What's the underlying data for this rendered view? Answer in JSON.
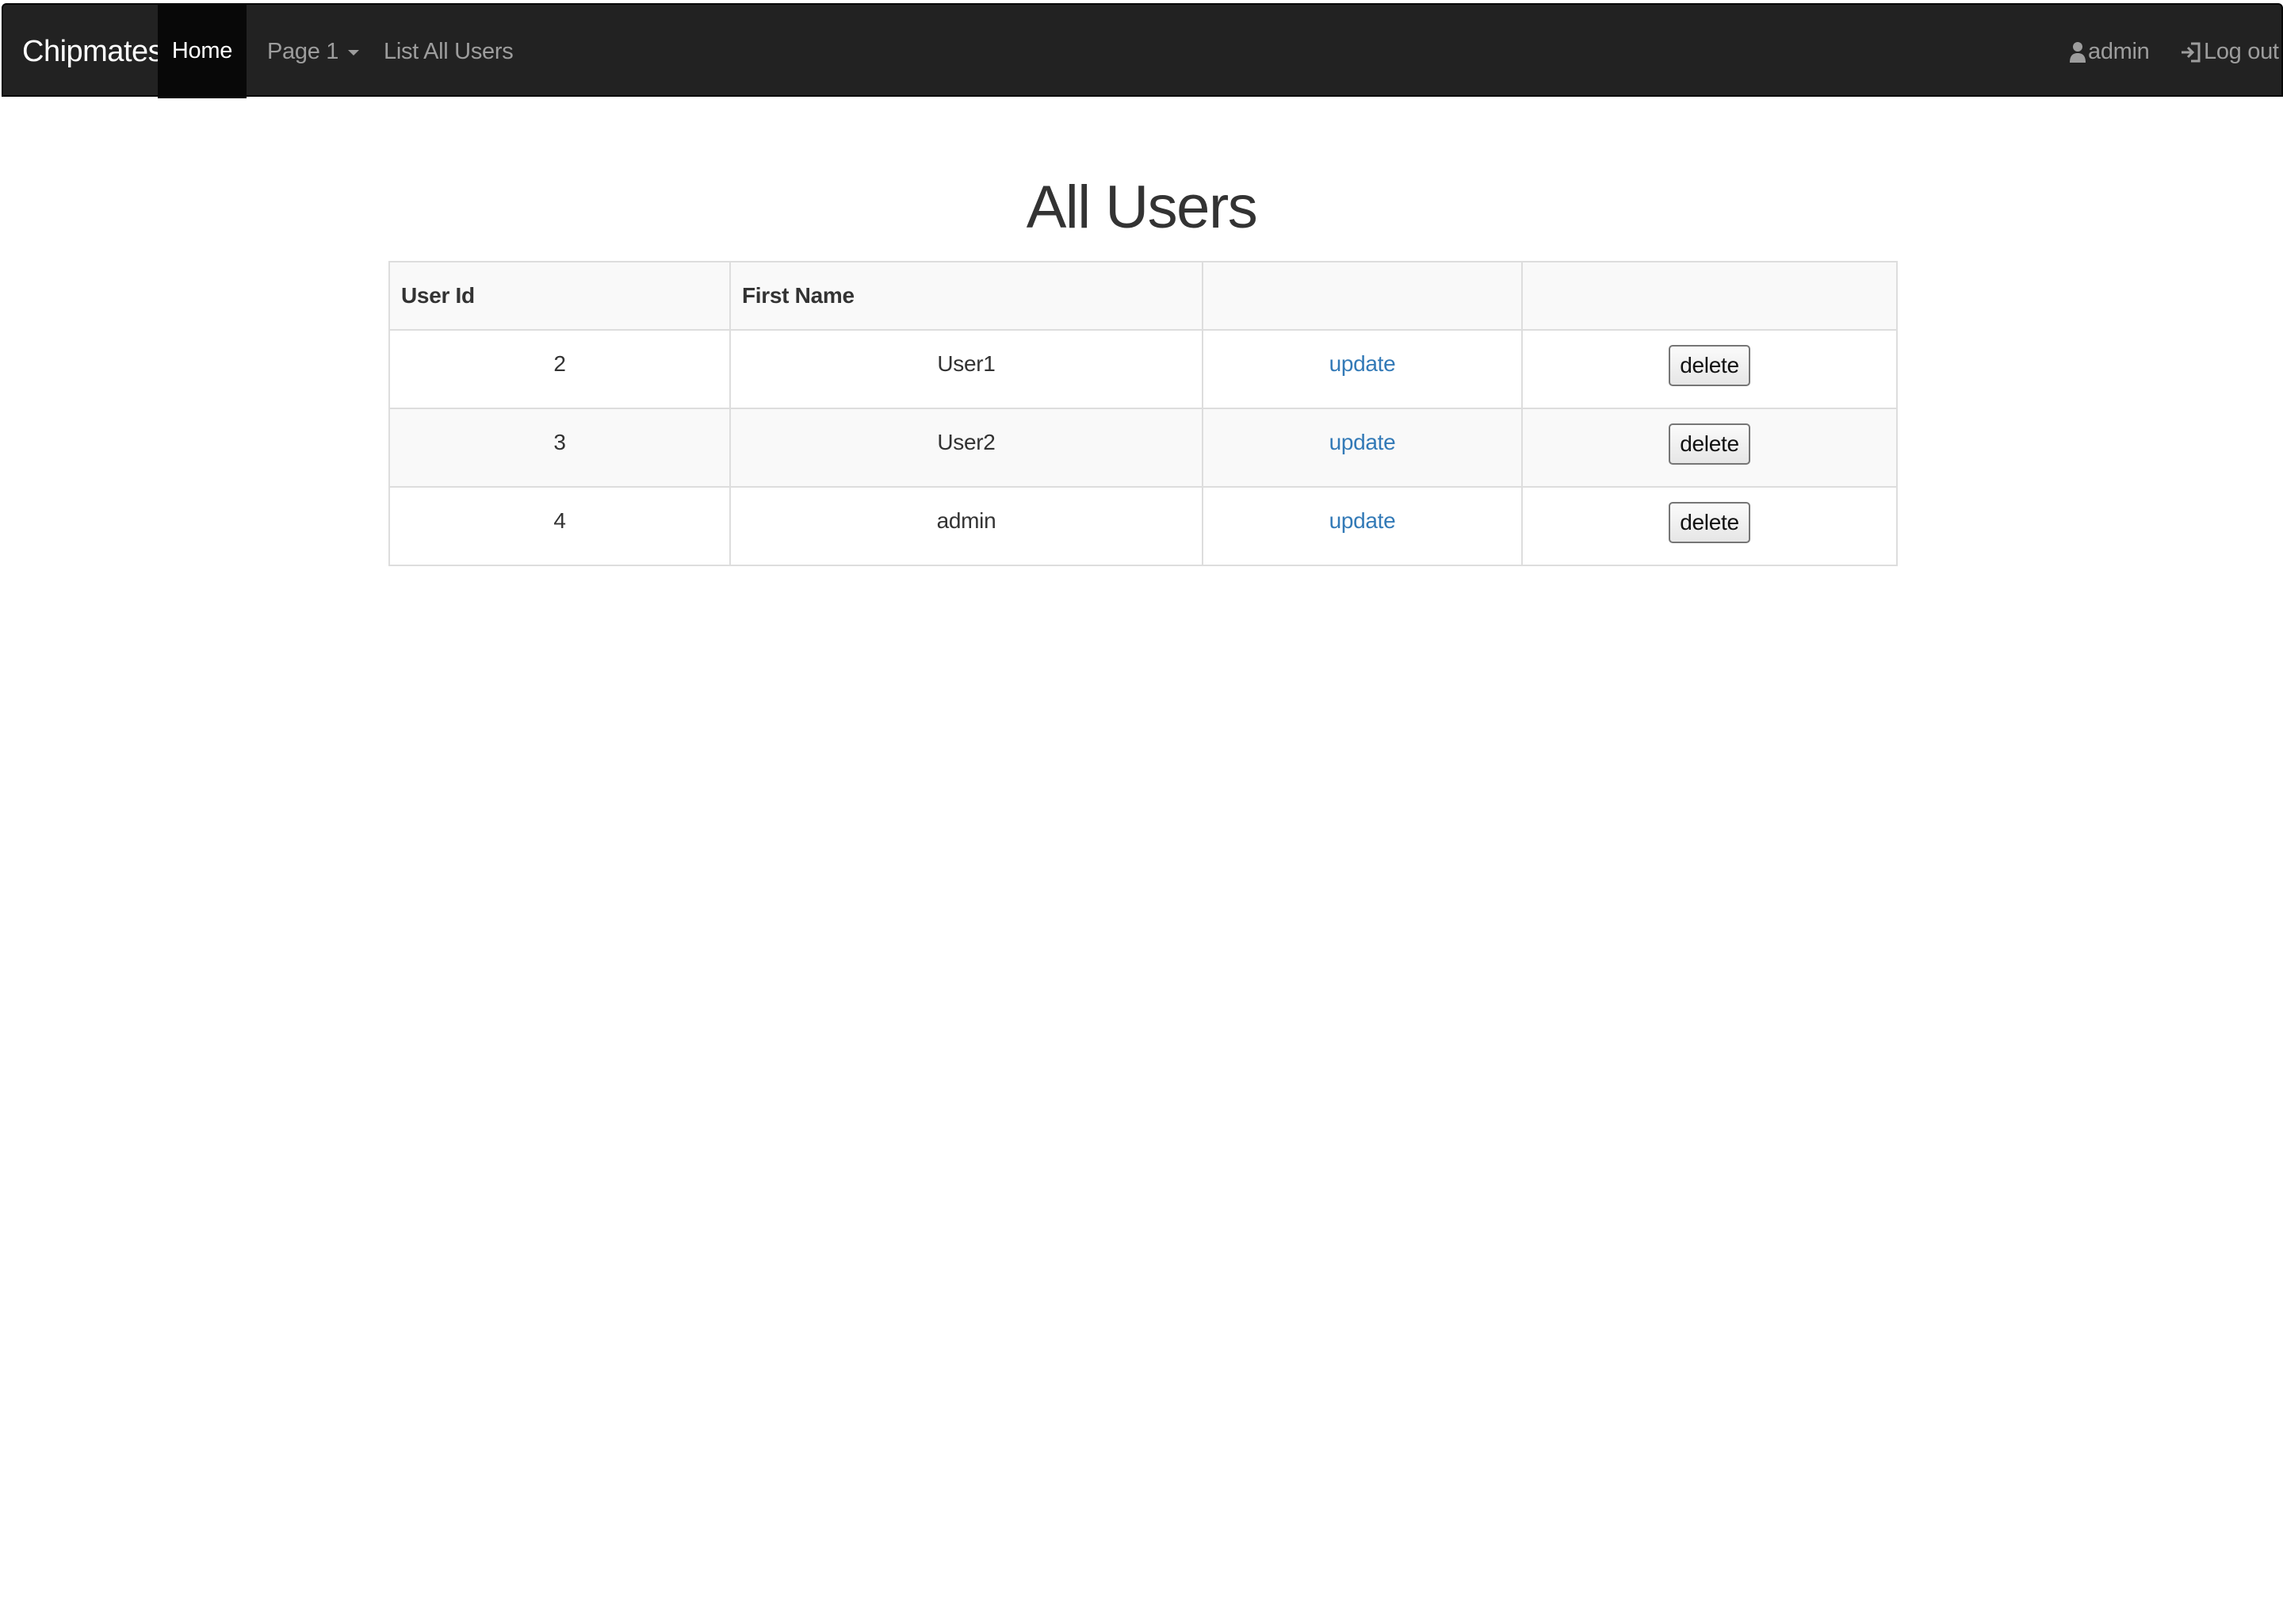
{
  "navbar": {
    "brand": "Chipmates",
    "items": [
      {
        "label": "Home",
        "active": true
      },
      {
        "label": "Page 1",
        "dropdown": true
      },
      {
        "label": "List All Users"
      }
    ],
    "right": {
      "user": {
        "label": "admin",
        "icon": "user-icon"
      },
      "logout": {
        "label": "Log out",
        "icon": "log-in-icon"
      }
    }
  },
  "main": {
    "title": "All Users",
    "table": {
      "headers": [
        "User Id",
        "First Name",
        "",
        ""
      ],
      "rows": [
        {
          "id": "2",
          "first_name": "User1",
          "update": "update",
          "delete": "delete"
        },
        {
          "id": "3",
          "first_name": "User2",
          "update": "update",
          "delete": "delete"
        },
        {
          "id": "4",
          "first_name": "admin",
          "update": "update",
          "delete": "delete"
        }
      ]
    }
  },
  "colors": {
    "navbar_bg": "#222222",
    "navbar_active_bg": "#080808",
    "nav_text": "#9d9d9d",
    "link": "#337ab7",
    "table_border": "#dddddd",
    "table_stripe": "#f9f9f9"
  }
}
